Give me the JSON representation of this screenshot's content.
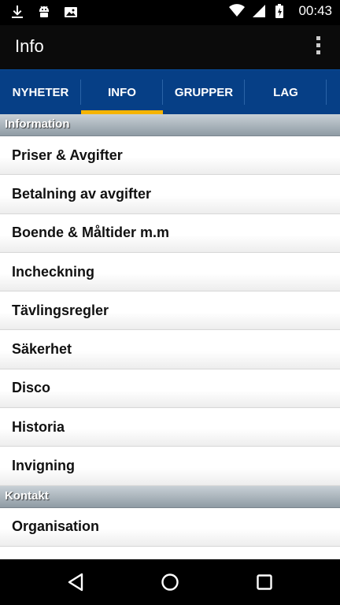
{
  "status_bar": {
    "time": "00:43",
    "left_icons": [
      "download-icon",
      "android-icon",
      "photo-icon"
    ],
    "right_icons": [
      "wifi-icon",
      "signal-icon",
      "battery-charging-icon"
    ]
  },
  "app_bar": {
    "title": "Info",
    "overflow_icon": "more-vert-icon"
  },
  "tabs": [
    {
      "label": "NYHETER",
      "selected": false
    },
    {
      "label": "INFO",
      "selected": true
    },
    {
      "label": "GRUPPER",
      "selected": false
    },
    {
      "label": "LAG",
      "selected": false
    }
  ],
  "tab_indicator_color": "#f5b400",
  "tab_bar_color": "#063f86",
  "sections": [
    {
      "header": "Information",
      "items": [
        "Priser & Avgifter",
        "Betalning av avgifter",
        "Boende & Måltider m.m",
        "Incheckning",
        "Tävlingsregler",
        "Säkerhet",
        "Disco",
        "Historia",
        "Invigning"
      ]
    },
    {
      "header": "Kontakt",
      "items": [
        "Organisation"
      ]
    }
  ],
  "nav_bar": {
    "buttons": [
      "back-icon",
      "home-icon",
      "recents-icon"
    ]
  }
}
